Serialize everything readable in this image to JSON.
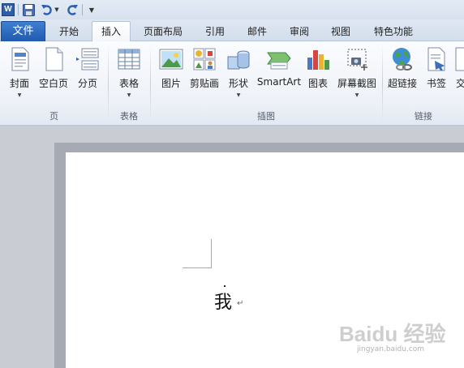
{
  "qat": {
    "app_icon_letter": "W",
    "icons": [
      "word-app-icon",
      "save-icon",
      "undo-icon",
      "redo-icon",
      "customize-qat-icon"
    ]
  },
  "tabs": {
    "file": "文件",
    "items": [
      "开始",
      "插入",
      "页面布局",
      "引用",
      "邮件",
      "审阅",
      "视图",
      "特色功能"
    ],
    "active": "插入"
  },
  "ribbon": {
    "groups": {
      "pages": {
        "label": "页",
        "buttons": [
          "封面",
          "空白页",
          "分页"
        ]
      },
      "tables": {
        "label": "表格",
        "buttons": [
          "表格"
        ]
      },
      "illustrations": {
        "label": "插图",
        "buttons": [
          "图片",
          "剪贴画",
          "形状",
          "SmartArt",
          "图表",
          "屏幕截图"
        ]
      },
      "links": {
        "label": "链接",
        "buttons": [
          "超链接",
          "书签",
          "交"
        ]
      }
    }
  },
  "document": {
    "text": "我",
    "paragraph_mark": "↵"
  },
  "watermark": {
    "main": "Baidu 经验",
    "sub": "jingyan.baidu.com"
  },
  "colors": {
    "file_tab": "#2a67bf",
    "ribbon_bg": "#f3f6fb",
    "doc_bg": "#c9cdd3"
  }
}
